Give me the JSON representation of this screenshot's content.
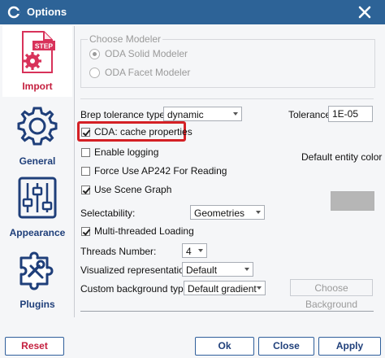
{
  "window": {
    "title": "Options"
  },
  "sidebar": {
    "items": [
      {
        "label": "Import",
        "icon": "step-file-import-icon",
        "active": true
      },
      {
        "label": "General",
        "icon": "gear-icon",
        "active": false
      },
      {
        "label": "Appearance",
        "icon": "sliders-icon",
        "active": false
      },
      {
        "label": "Plugins",
        "icon": "puzzle-icon",
        "active": false
      }
    ],
    "import_icon_text": "STEP"
  },
  "modeler": {
    "legend": "Choose Modeler",
    "options": [
      {
        "label": "ODA Solid Modeler",
        "selected": true
      },
      {
        "label": "ODA Facet Modeler",
        "selected": false
      }
    ]
  },
  "brep": {
    "label": "Brep tolerance type:",
    "value": "dynamic"
  },
  "tolerance": {
    "label": "Tolerance:",
    "value": "1E-05"
  },
  "checkboxes": {
    "cda": {
      "label": "CDA: cache properties",
      "checked": true
    },
    "logging": {
      "label": "Enable logging",
      "checked": false
    },
    "ap242": {
      "label": "Force Use AP242 For Reading",
      "checked": false
    },
    "scene_graph": {
      "label": "Use Scene Graph",
      "checked": true
    },
    "multithread": {
      "label": "Multi-threaded Loading",
      "checked": true
    }
  },
  "default_entity_color": {
    "label": "Default entity color",
    "color": "#b6b6b6"
  },
  "selectability": {
    "label": "Selectability:",
    "value": "Geometries"
  },
  "threads": {
    "label": "Threads Number:",
    "value": "4"
  },
  "visualized": {
    "label": "Visualized representation:",
    "value": "Default"
  },
  "background": {
    "label": "Custom background type:",
    "value": "Default gradient",
    "choose_label": "Choose Background"
  },
  "footer": {
    "reset": "Reset",
    "ok": "Ok",
    "close": "Close",
    "apply": "Apply"
  },
  "colors": {
    "titlebar": "#2d6397",
    "highlight": "#d42025",
    "accent_red": "#c41f3e"
  }
}
